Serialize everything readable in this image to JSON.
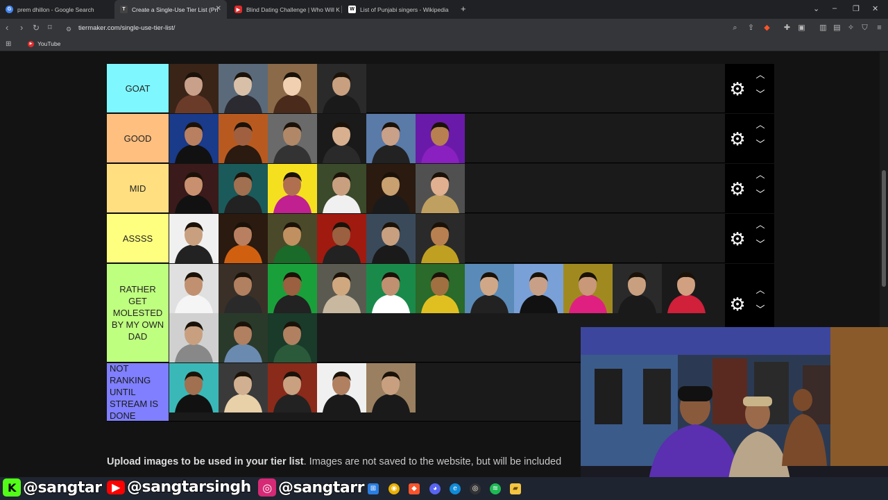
{
  "browser": {
    "tabs": [
      {
        "title": "prem dhillon - Google Search",
        "favicon": "google-icon",
        "color": "#4285f4"
      },
      {
        "title": "Create a Single-Use Tier List (Pri",
        "favicon": "tiermaker-icon",
        "color": "#333333",
        "active": true
      },
      {
        "title": "Blind Dating Challenge | Who Will K",
        "favicon": "youtube-icon",
        "color": "#e02b2b"
      },
      {
        "title": "List of Punjabi singers - Wikipedia",
        "favicon": "wikipedia-icon",
        "color": "#ffffff"
      }
    ],
    "new_tab": "+",
    "url": "tiermaker.com/single-use-tier-list/",
    "bookmarks": [
      {
        "label": "YouTube"
      }
    ]
  },
  "tiers": [
    {
      "label": "GOAT",
      "color": "#7ff7ff",
      "count": 4,
      "left": false
    },
    {
      "label": "GOOD",
      "color": "#ffbf7f",
      "count": 6,
      "left": false
    },
    {
      "label": "MID",
      "color": "#ffdf80",
      "count": 6,
      "left": false
    },
    {
      "label": "ASSSS",
      "color": "#ffff7f",
      "count": 6,
      "left": false
    },
    {
      "label": "RATHER GET MOLESTED BY MY OWN DAD",
      "color": "#bfff7f",
      "count": 14,
      "left": false
    },
    {
      "label": "NOT RANKING UNTIL STREAM IS DONE",
      "color": "#7f7fff",
      "count": 5,
      "left": true
    }
  ],
  "controls": {
    "settings_icon": "gear-icon",
    "up_icon": "chevron-up-icon",
    "down_icon": "chevron-down-icon"
  },
  "upload": {
    "bold": "Upload images to be used in your tier list",
    "rest": ". Images are not saved to the website, but will be included"
  },
  "socials": [
    {
      "handle": "@sangtar",
      "icon": "kick-icon",
      "color": "#53fc18"
    },
    {
      "handle": "@sangtarsingh",
      "icon": "youtube-icon",
      "color": "#ff0000"
    },
    {
      "handle": "@sangtarr",
      "icon": "instagram-icon",
      "color": "#d62976"
    }
  ]
}
